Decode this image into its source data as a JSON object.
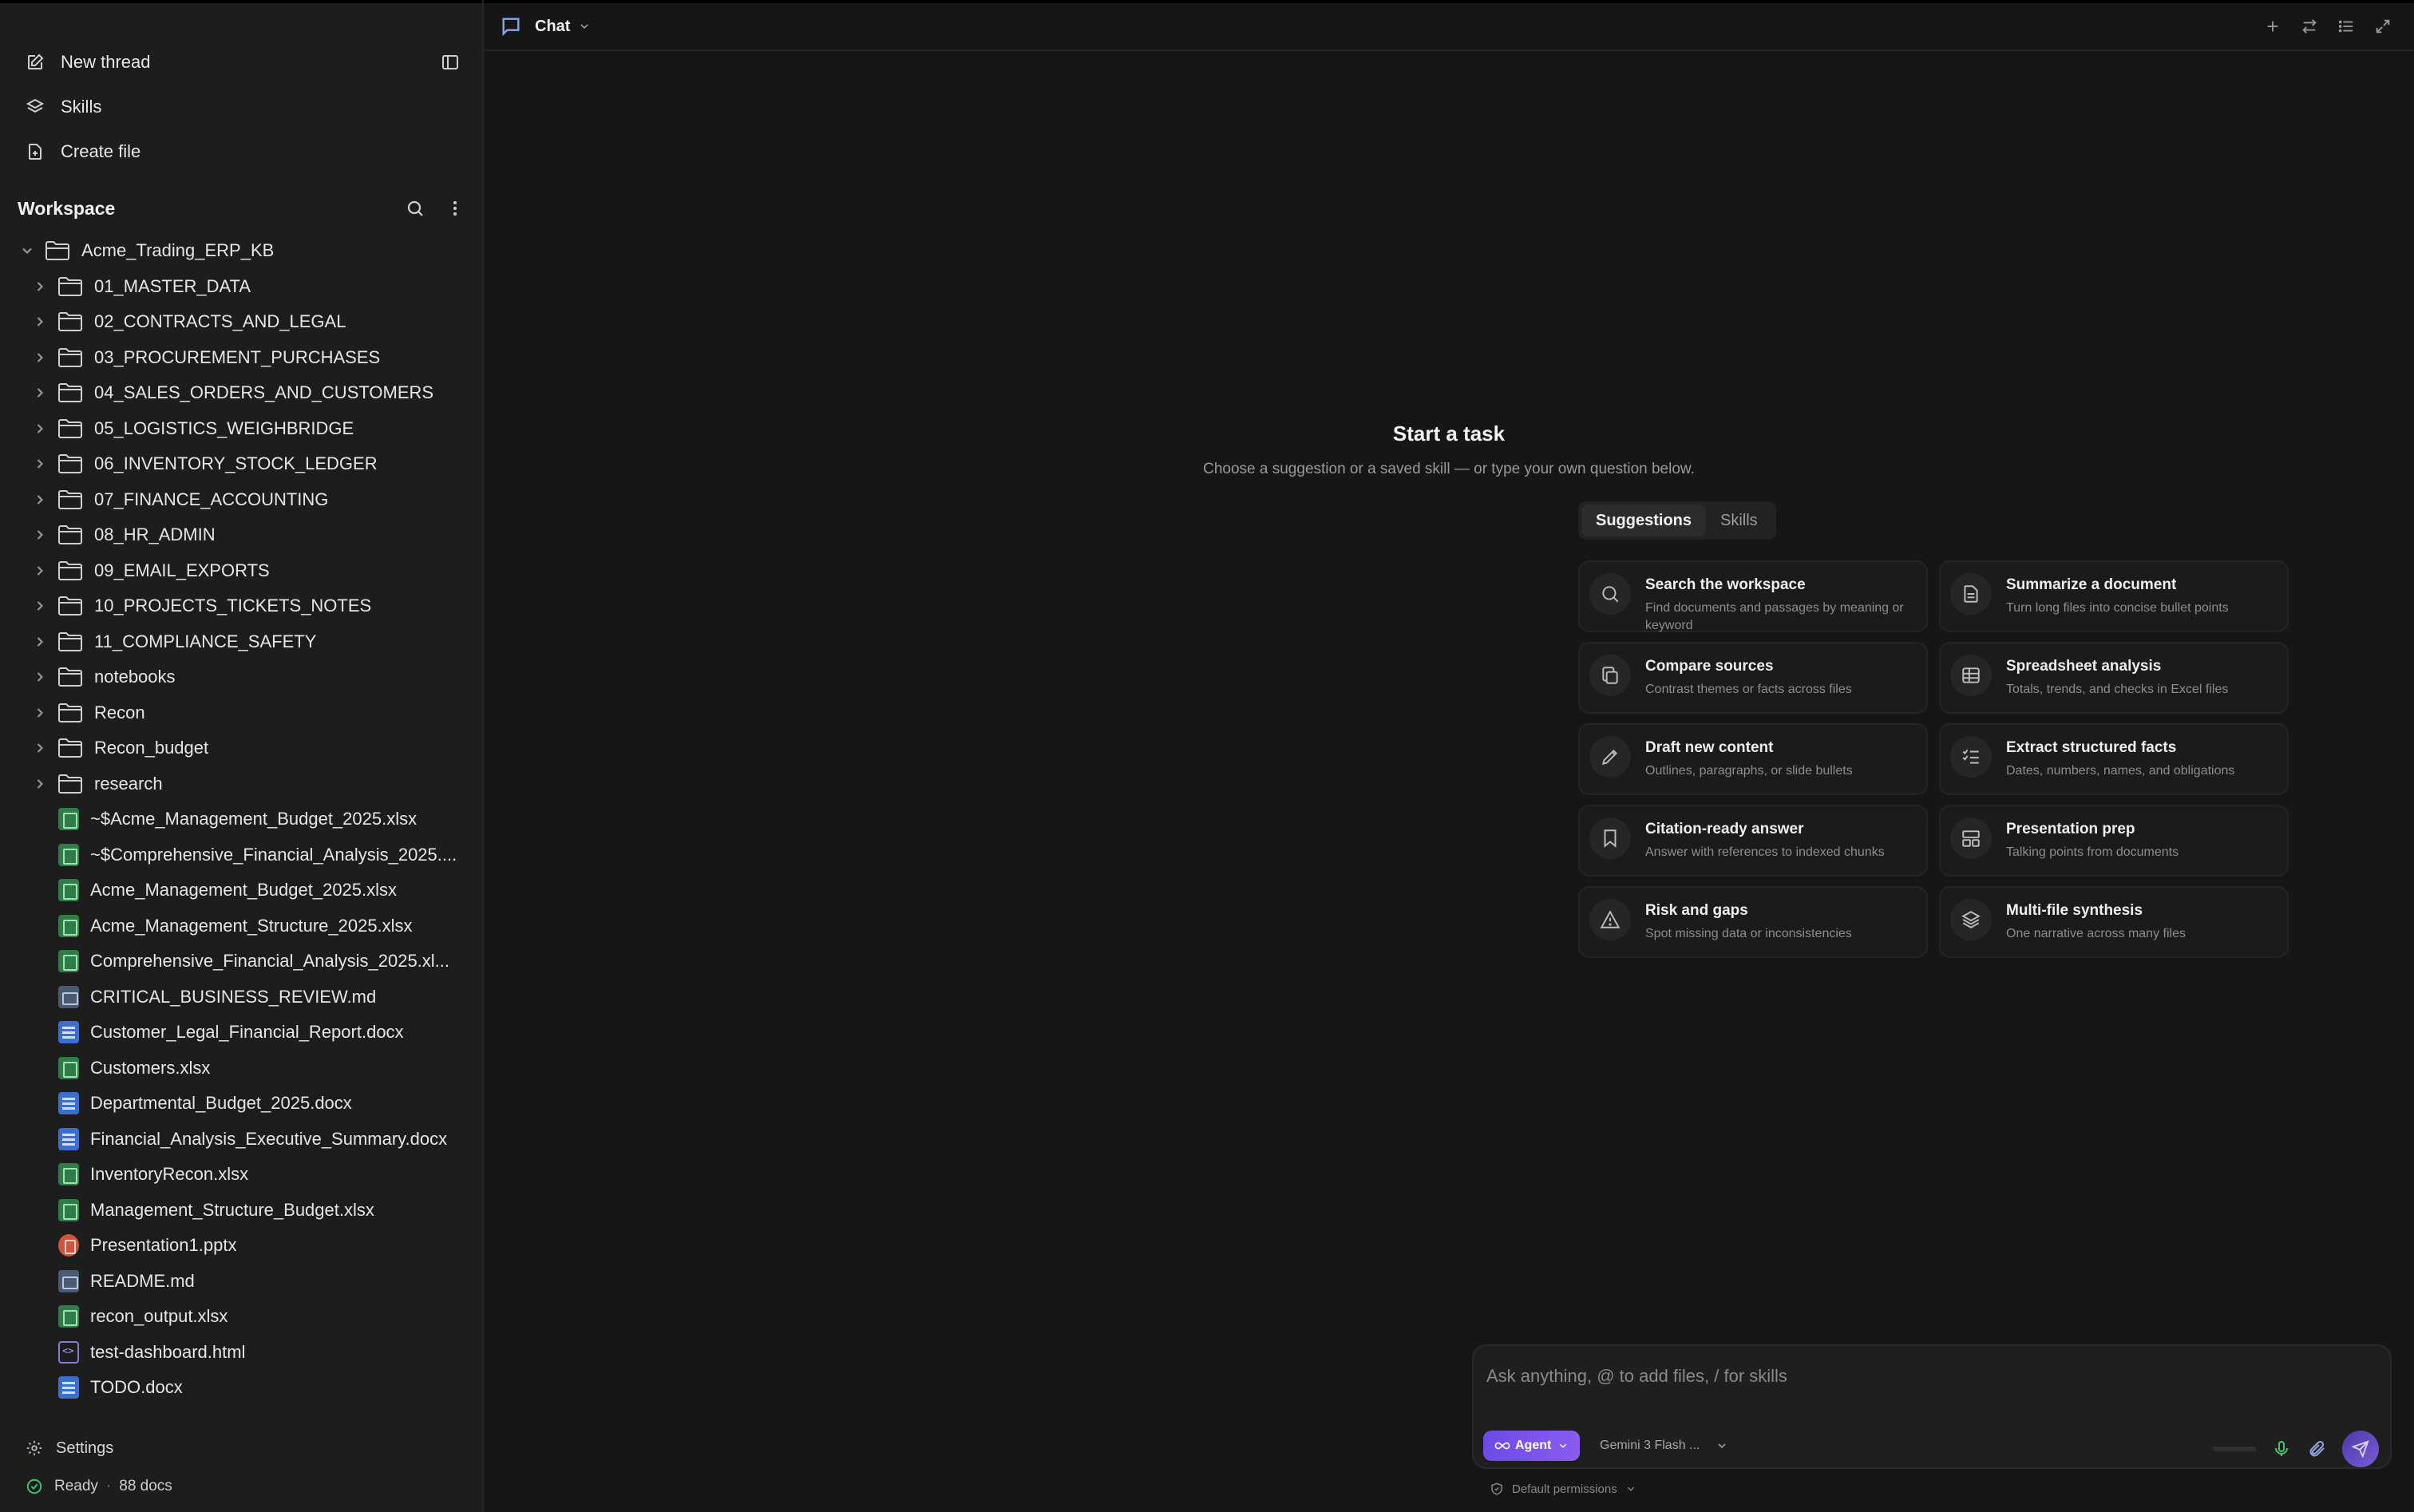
{
  "sidebar": {
    "actions": {
      "new_thread": "New thread",
      "skills": "Skills",
      "create_file": "Create file"
    },
    "workspace_title": "Workspace",
    "root_folder": "Acme_Trading_ERP_KB",
    "folders": [
      "01_MASTER_DATA",
      "02_CONTRACTS_AND_LEGAL",
      "03_PROCUREMENT_PURCHASES",
      "04_SALES_ORDERS_AND_CUSTOMERS",
      "05_LOGISTICS_WEIGHBRIDGE",
      "06_INVENTORY_STOCK_LEDGER",
      "07_FINANCE_ACCOUNTING",
      "08_HR_ADMIN",
      "09_EMAIL_EXPORTS",
      "10_PROJECTS_TICKETS_NOTES",
      "11_COMPLIANCE_SAFETY",
      "notebooks",
      "Recon",
      "Recon_budget",
      "research"
    ],
    "files": [
      {
        "name": "~$Acme_Management_Budget_2025.xlsx",
        "type": "xls"
      },
      {
        "name": "~$Comprehensive_Financial_Analysis_2025....",
        "type": "xls"
      },
      {
        "name": "Acme_Management_Budget_2025.xlsx",
        "type": "xls"
      },
      {
        "name": "Acme_Management_Structure_2025.xlsx",
        "type": "xls"
      },
      {
        "name": "Comprehensive_Financial_Analysis_2025.xl...",
        "type": "xls"
      },
      {
        "name": "CRITICAL_BUSINESS_REVIEW.md",
        "type": "md"
      },
      {
        "name": "Customer_Legal_Financial_Report.docx",
        "type": "doc"
      },
      {
        "name": "Customers.xlsx",
        "type": "xls"
      },
      {
        "name": "Departmental_Budget_2025.docx",
        "type": "doc"
      },
      {
        "name": "Financial_Analysis_Executive_Summary.docx",
        "type": "doc"
      },
      {
        "name": "InventoryRecon.xlsx",
        "type": "xls"
      },
      {
        "name": "Management_Structure_Budget.xlsx",
        "type": "xls"
      },
      {
        "name": "Presentation1.pptx",
        "type": "ppt"
      },
      {
        "name": "README.md",
        "type": "md"
      },
      {
        "name": "recon_output.xlsx",
        "type": "xls"
      },
      {
        "name": "test-dashboard.html",
        "type": "html"
      },
      {
        "name": "TODO.docx",
        "type": "doc"
      }
    ],
    "footer": {
      "settings": "Settings",
      "status": "Ready",
      "doc_count": "88 docs"
    }
  },
  "topbar": {
    "title": "Chat"
  },
  "start": {
    "title": "Start a task",
    "subtitle": "Choose a suggestion or a saved skill — or type your own question below.",
    "tabs": [
      "Suggestions",
      "Skills"
    ],
    "active_tab": "Suggestions",
    "cards": [
      {
        "icon": "search-icon",
        "title": "Search the workspace",
        "desc": "Find documents and passages by meaning or keyword"
      },
      {
        "icon": "document-icon",
        "title": "Summarize a document",
        "desc": "Turn long files into concise bullet points"
      },
      {
        "icon": "copy-icon",
        "title": "Compare sources",
        "desc": "Contrast themes or facts across files"
      },
      {
        "icon": "table-icon",
        "title": "Spreadsheet analysis",
        "desc": "Totals, trends, and checks in Excel files"
      },
      {
        "icon": "pencil-icon",
        "title": "Draft new content",
        "desc": "Outlines, paragraphs, or slide bullets"
      },
      {
        "icon": "checklist-icon",
        "title": "Extract structured facts",
        "desc": "Dates, numbers, names, and obligations"
      },
      {
        "icon": "bookmark-icon",
        "title": "Citation-ready answer",
        "desc": "Answer with references to indexed chunks"
      },
      {
        "icon": "layout-icon",
        "title": "Presentation prep",
        "desc": "Talking points from documents"
      },
      {
        "icon": "warning-icon",
        "title": "Risk and gaps",
        "desc": "Spot missing data or inconsistencies"
      },
      {
        "icon": "layers-icon",
        "title": "Multi-file synthesis",
        "desc": "One narrative across many files"
      }
    ]
  },
  "composer": {
    "placeholder": "Ask anything, @ to add files, / for skills",
    "agent_label": "Agent",
    "model_label": "Gemini 3 Flash ...",
    "permissions": "Default permissions"
  },
  "colors": {
    "accent": "#7b5cd6",
    "status_ok": "#3fbf6f"
  }
}
